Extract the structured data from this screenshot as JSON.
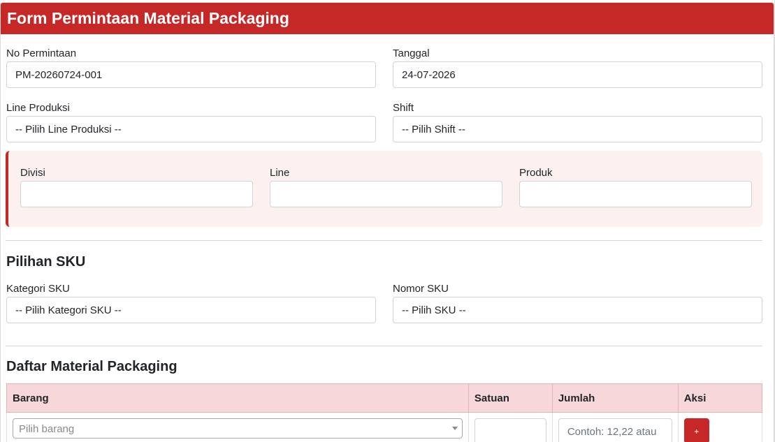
{
  "header": {
    "title": "Form Permintaan Material Packaging"
  },
  "form": {
    "no_permintaan": {
      "label": "No Permintaan",
      "value": "PM-20260724-001"
    },
    "tanggal": {
      "label": "Tanggal",
      "value": "24-07-2026"
    },
    "line_produksi": {
      "label": "Line Produksi",
      "value": "-- Pilih Line Produksi --"
    },
    "shift": {
      "label": "Shift",
      "value": "-- Pilih Shift --"
    }
  },
  "info_panel": {
    "divisi": {
      "label": "Divisi",
      "value": ""
    },
    "line": {
      "label": "Line",
      "value": ""
    },
    "produk": {
      "label": "Produk",
      "value": ""
    },
    "accent_color": "#c62828",
    "background": "#fdf1f0"
  },
  "sku": {
    "heading": "Pilihan SKU",
    "kategori": {
      "label": "Kategori SKU",
      "value": "-- Pilih Kategori SKU --"
    },
    "nomor": {
      "label": "Nomor SKU",
      "value": "-- Pilih SKU --"
    }
  },
  "materials": {
    "heading": "Daftar Material Packaging",
    "columns": [
      "Barang",
      "Satuan",
      "Jumlah",
      "Aksi"
    ],
    "rows": [
      {
        "barang_placeholder": "Pilih barang",
        "satuan": "",
        "jumlah_placeholder": "Contoh: 12,22 atau",
        "action_label": "+"
      }
    ]
  },
  "colors": {
    "brand": "#c62828",
    "table_header": "#f8d7da"
  }
}
